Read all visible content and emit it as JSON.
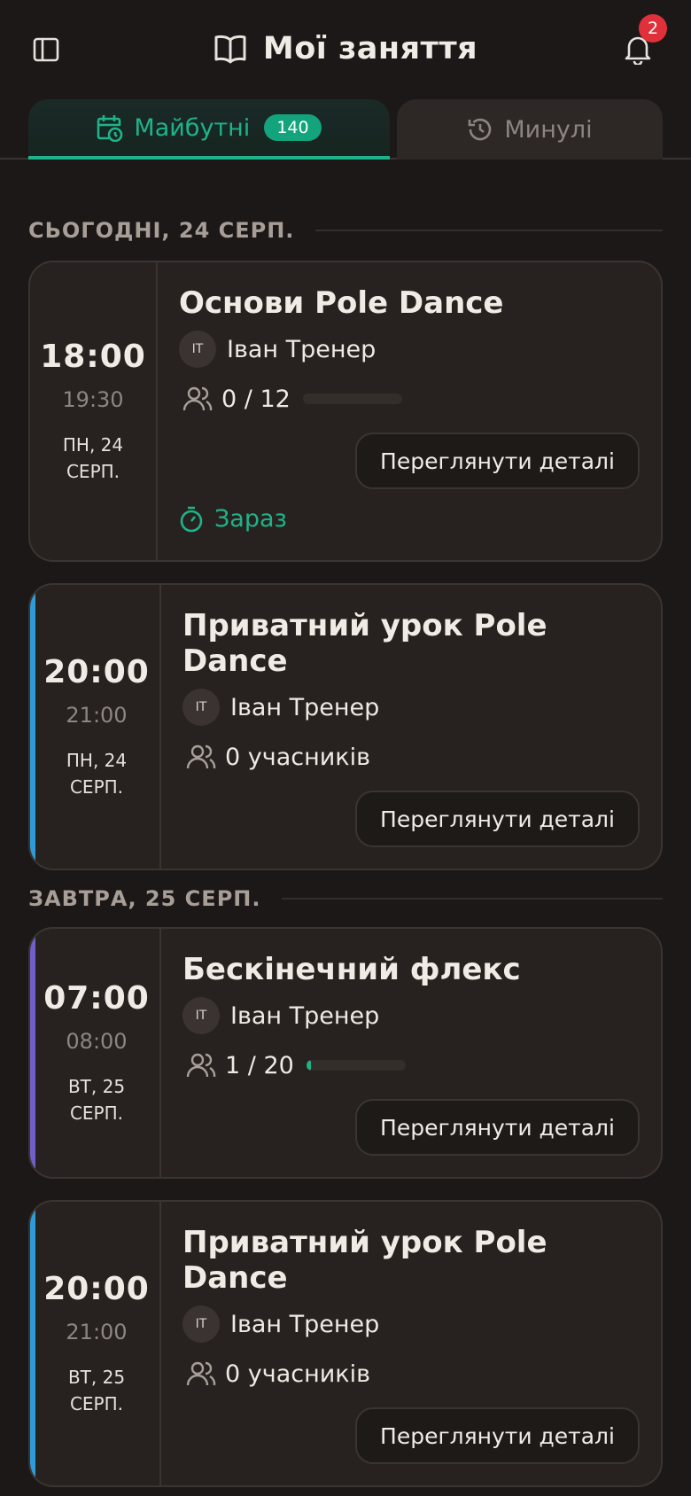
{
  "header": {
    "title": "Мої заняття",
    "notification_count": "2"
  },
  "tabs": [
    {
      "label": "Майбутні",
      "count": "140",
      "active": true
    },
    {
      "label": "Минулі",
      "active": false
    }
  ],
  "sections": [
    {
      "title": "СЬОГОДНІ, 24 СЕРП."
    },
    {
      "title": "ЗАВТРА, 25 СЕРП."
    }
  ],
  "classes": [
    {
      "title": "Основи Pole Dance",
      "start": "18:00",
      "end": "19:30",
      "day": "ПН, 24",
      "month": "СЕРП.",
      "trainer_initials": "IT",
      "trainer": "Іван Тренер",
      "attendance": "0 / 12",
      "fill": 0,
      "button": "Переглянути деталі",
      "status": "Зараз",
      "accent": ""
    },
    {
      "title": "Приватний урок Pole Dance",
      "start": "20:00",
      "end": "21:00",
      "day": "ПН, 24",
      "month": "СЕРП.",
      "trainer_initials": "IT",
      "trainer": "Іван Тренер",
      "attendance": "0 учасників",
      "button": "Переглянути деталі",
      "accent": "#2f9bd8"
    },
    {
      "title": "Бескінечний флекс",
      "start": "07:00",
      "end": "08:00",
      "day": "ВТ, 25",
      "month": "СЕРП.",
      "trainer_initials": "IT",
      "trainer": "Іван Тренер",
      "attendance": "1 / 20",
      "fill": 0.05,
      "button": "Переглянути деталі",
      "accent": "#6f5fc9"
    },
    {
      "title": "Приватний урок Pole Dance",
      "start": "20:00",
      "end": "21:00",
      "day": "ВТ, 25",
      "month": "СЕРП.",
      "trainer_initials": "IT",
      "trainer": "Іван Тренер",
      "attendance": "0 учасників",
      "button": "Переглянути деталі",
      "accent": "#2f9bd8"
    }
  ]
}
